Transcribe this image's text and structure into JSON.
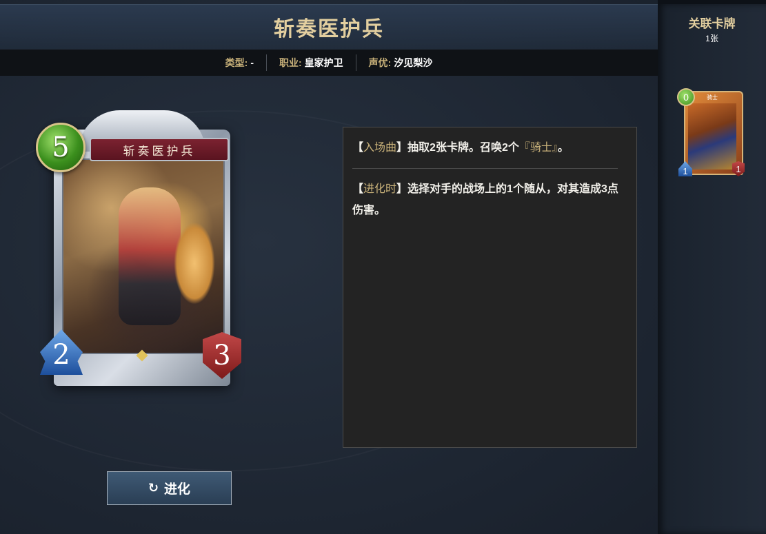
{
  "card": {
    "name": "斩奏医护兵",
    "cost": "5",
    "attack": "2",
    "defense": "3"
  },
  "meta": {
    "type_label": "类型:",
    "type_value": "-",
    "class_label": "职业:",
    "class_value": "皇家护卫",
    "cv_label": "声优:",
    "cv_value": "汐见梨沙"
  },
  "abilities": {
    "fanfare": {
      "open": "【",
      "keyword": "入场曲",
      "close": "】",
      "text": "抽取2张卡牌。召唤2个",
      "token": "『骑士』",
      "end": "。"
    },
    "evolve": {
      "open": "【",
      "keyword": "进化时",
      "close": "】",
      "text": "选择对手的战场上的1个随从，对其造成3点伤害。"
    }
  },
  "evolve_button": {
    "label": "进化",
    "icon": "refresh-icon"
  },
  "sidebar": {
    "title": "关联卡牌",
    "count": "1张",
    "related": [
      {
        "name": "骑士",
        "cost": "0",
        "attack": "1",
        "defense": "1"
      }
    ]
  },
  "colors": {
    "gold": "#c9b27a",
    "title_gold": "#e3cf9f",
    "cost_green": "#3b8f1d",
    "atk_blue": "#1d4f9c",
    "def_red": "#7d1a1a"
  }
}
